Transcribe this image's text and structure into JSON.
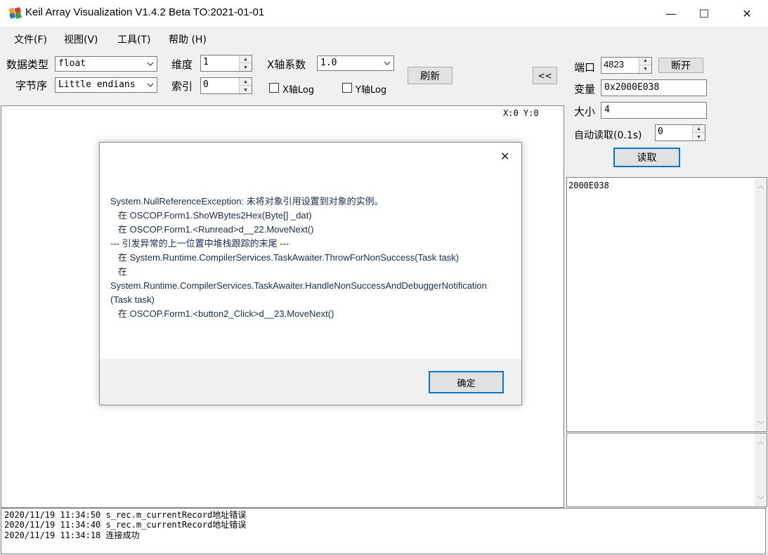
{
  "window": {
    "title": "Keil Array Visualization V1.4.2 Beta TO:2021-01-01",
    "minimize_glyph": "—",
    "maximize_glyph": "☐",
    "close_glyph": "✕"
  },
  "menu": [
    "文件(F)",
    "视图(V)",
    "工具(T)",
    "帮助 (H)"
  ],
  "controls": {
    "datatype_label": "数据类型",
    "datatype_value": "float",
    "endian_label": "字节序",
    "endian_value": "Little endians",
    "dim_label": "维度",
    "dim_value": "1",
    "index_label": "索引",
    "index_value": "0",
    "xcoef_label": "X轴系数",
    "xcoef_value": "1.0",
    "xlog_label": "X轴Log",
    "ylog_label": "Y轴Log",
    "refresh_label": "刷新",
    "collapse_label": "<<"
  },
  "right_panel": {
    "port_label": "端口",
    "port_value": "4823",
    "disconnect_label": "断开",
    "var_label": "变量",
    "var_value": "0x2000E038",
    "size_label": "大小",
    "size_value": "4",
    "auto_label": "自动读取(0.1s)",
    "auto_value": "0",
    "read_label": "读取",
    "hex_text": "2000E038"
  },
  "plot": {
    "coords": "X:0 Y:0"
  },
  "dialog": {
    "close_glyph": "✕",
    "message": "System.NullReferenceException: 未将对象引用设置到对象的实例。\n   在 OSCOP.Form1.ShoWBytes2Hex(Byte[] _dat)\n   在 OSCOP.Form1.<Runread>d__22.MoveNext()\n--- 引发异常的上一位置中堆栈跟踪的末尾 ---\n   在 System.Runtime.CompilerServices.TaskAwaiter.ThrowForNonSuccess(Task task)\n   在\nSystem.Runtime.CompilerServices.TaskAwaiter.HandleNonSuccessAndDebuggerNotification(Task task)\n   在 OSCOP.Form1.<button2_Click>d__23.MoveNext()",
    "ok_label": "确定"
  },
  "log": [
    "2020/11/19 11:34:50 s_rec.m_currentRecord地址错误",
    "2020/11/19 11:34:40 s_rec.m_currentRecord地址错误",
    "2020/11/19 11:34:18 连接成功"
  ]
}
